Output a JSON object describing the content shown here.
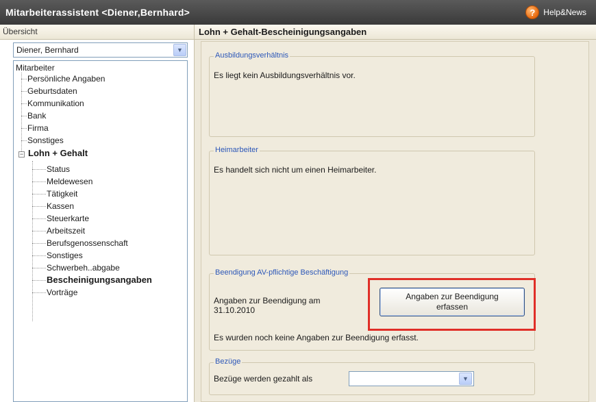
{
  "window": {
    "title": "Mitarbeiterassistent <Diener,Bernhard>",
    "help_label": "Help&News",
    "help_icon": "?"
  },
  "left": {
    "header": "Übersicht",
    "employee_select": {
      "value": "Diener, Bernhard"
    },
    "tree": {
      "root": "Mitarbeiter",
      "items": [
        "Persönliche Angaben",
        "Geburtsdaten",
        "Kommunikation",
        "Bank",
        "Firma",
        "Sonstiges"
      ],
      "expanded_group": {
        "expander": "−",
        "label": "Lohn + Gehalt",
        "children": [
          "Status",
          "Meldewesen",
          "Tätigkeit",
          "Kassen",
          "Steuerkarte",
          "Arbeitszeit",
          "Berufsgenossenschaft",
          "Sonstiges",
          "Schwerbeh..abgabe",
          "Bescheinigungsangaben",
          "Vorträge"
        ],
        "selected_child": "Bescheinigungsangaben"
      }
    }
  },
  "right": {
    "header": "Lohn + Gehalt-Bescheinigungsangaben",
    "groups": {
      "ausbildung": {
        "legend": "Ausbildungsverhältnis",
        "text": "Es liegt kein Ausbildungsverhältnis vor."
      },
      "heimarbeiter": {
        "legend": "Heimarbeiter",
        "text": "Es handelt sich nicht um einen Heimarbeiter."
      },
      "beendigung": {
        "legend": "Beendigung AV-pflichtige Beschäftigung",
        "info_line1": "Angaben zur Beendigung am",
        "info_line2": "31.10.2010",
        "button_line1": "Angaben zur Beendigung",
        "button_line2": "erfassen",
        "status": "Es wurden noch keine Angaben zur Beendigung erfasst."
      },
      "bezuege": {
        "legend": "Bezüge",
        "label": "Bezüge werden gezahlt als",
        "select_value": ""
      }
    }
  },
  "colors": {
    "highlight": "#e02e27",
    "legend": "#2c57b8",
    "titlebar": "#3a3a3a"
  }
}
